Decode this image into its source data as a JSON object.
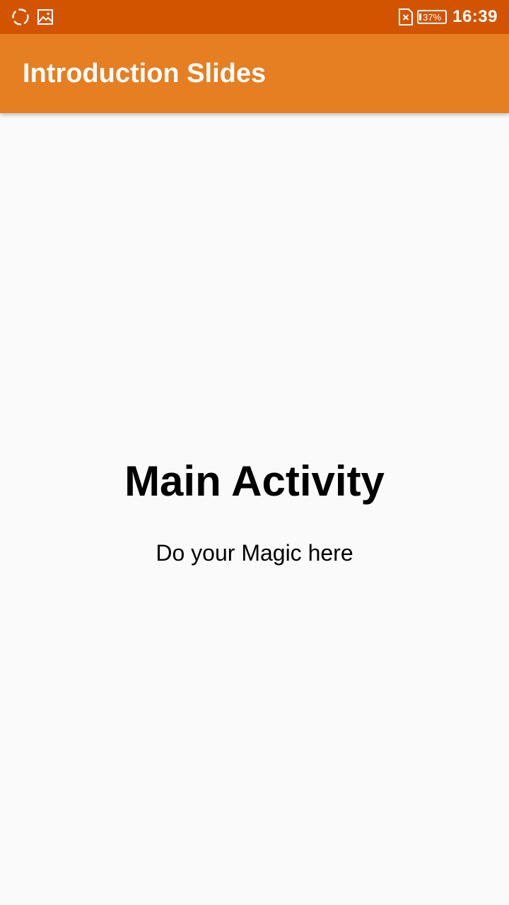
{
  "status_bar": {
    "left_icons": [
      "sync-circle-icon",
      "image-icon"
    ],
    "sim_icon": "no-sim-icon",
    "battery_percent": "37%",
    "time": "16:39",
    "color": "#d35400"
  },
  "app_bar": {
    "title": "Introduction Slides",
    "color": "#e67e22"
  },
  "main": {
    "heading": "Main Activity",
    "subtitle": "Do your Magic here"
  }
}
